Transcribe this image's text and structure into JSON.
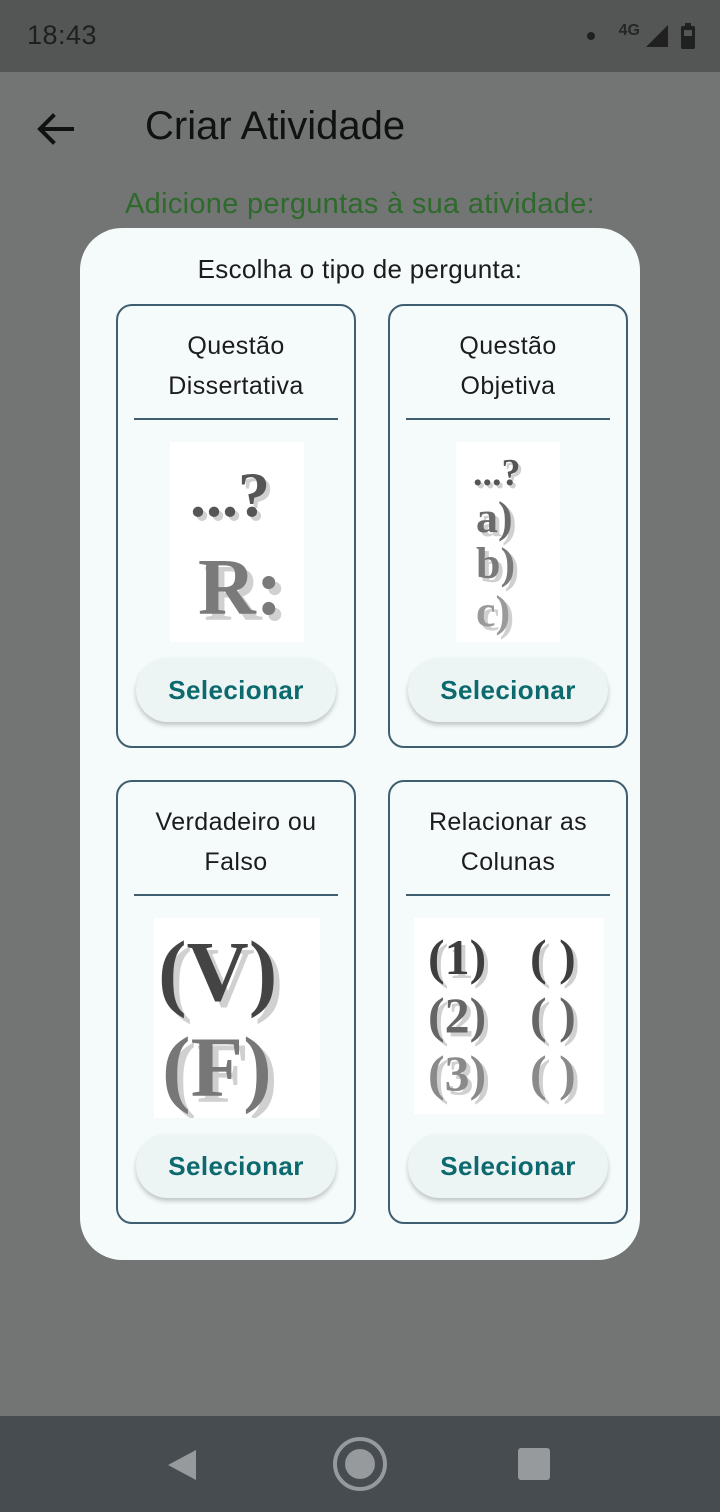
{
  "status_bar": {
    "time": "18:43",
    "network": "4G"
  },
  "app_bar": {
    "title": "Criar Atividade"
  },
  "subtitle": "Adicione perguntas à sua atividade:",
  "dialog": {
    "title": "Escolha o tipo de pergunta:",
    "cards": [
      {
        "title": "Questão\nDissertativa",
        "button": "Selecionar",
        "image_lines": [
          "...?",
          "R:"
        ]
      },
      {
        "title": "Questão\nObjetiva",
        "button": "Selecionar",
        "image_lines": [
          "...?",
          "a)",
          "b)",
          "c)"
        ]
      },
      {
        "title": "Verdadeiro ou\nFalso",
        "button": "Selecionar",
        "image_lines": [
          "(V)",
          "(F)"
        ]
      },
      {
        "title": "Relacionar as\nColunas",
        "button": "Selecionar",
        "image_lines": [
          "(1)",
          "( )",
          "(2)",
          "( )",
          "(3)",
          "( )"
        ]
      }
    ]
  },
  "colors": {
    "accent_text": "#2d6a2b",
    "button_text": "#0c6a6e",
    "card_border": "#3f5f70"
  }
}
